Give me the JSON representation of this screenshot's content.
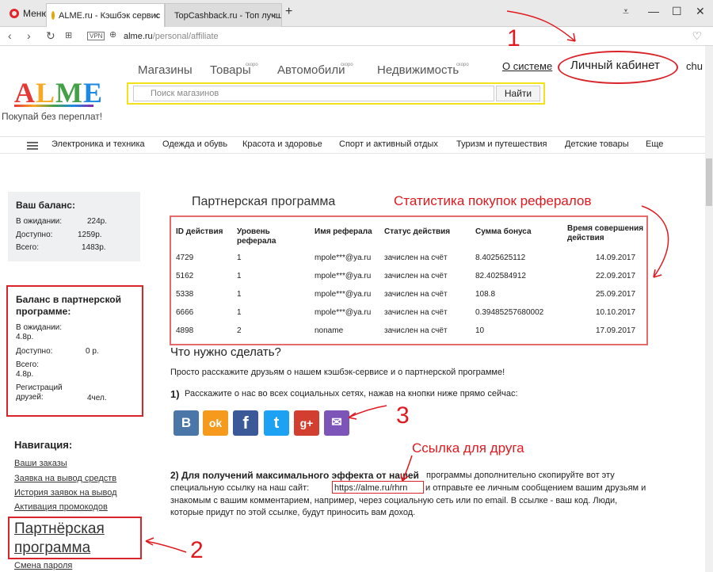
{
  "browser": {
    "menu_label": "Меню",
    "tabs": [
      {
        "title": "ALME.ru - Кэшбэк сервис",
        "close": "×"
      },
      {
        "title": "TopCashback.ru - Топ лучш",
        "close": "×"
      }
    ],
    "new_tab": "+",
    "url_host": "alme.ru",
    "url_path": "/personal/affiliate",
    "vpn_label": "VPN"
  },
  "header": {
    "logo_letters": [
      "A",
      "L",
      "M",
      "E"
    ],
    "slogan": "Покупай без переплат!",
    "nav": [
      {
        "label": "Магазины",
        "soon": ""
      },
      {
        "label": "Товары",
        "soon": "скоро"
      },
      {
        "label": "Автомобили",
        "soon": "скоро"
      },
      {
        "label": "Недвижимость",
        "soon": "скоро"
      }
    ],
    "about": "О системе",
    "cabinet": "Личный кабинет",
    "user_short": "chu",
    "search_placeholder": "Поиск магазинов",
    "search_button": "Найти",
    "categories": [
      "Электроника и техника",
      "Одежда и обувь",
      "Красота и здоровье",
      "Спорт и активный отдых",
      "Туризм и путешествия",
      "Детские товары",
      "Еще"
    ]
  },
  "sidebar": {
    "balance": {
      "title": "Ваш баланс:",
      "rows": [
        {
          "label": "В ожидании:",
          "value": "224р."
        },
        {
          "label": "Доступно:",
          "value": "1259р."
        },
        {
          "label": "Всего:",
          "value": "1483р."
        }
      ]
    },
    "partner_balance": {
      "title": "Баланс в партнерской программе:",
      "pending_label": "В ожидании:",
      "pending_value": "4.8р.",
      "available_label": "Доступно:",
      "available_value": "0 р.",
      "total_label": "Всего:",
      "total_value": "4.8р.",
      "registrations_label": "Регистраций друзей:",
      "registrations_value": "4чел."
    },
    "nav_title": "Навигация:",
    "nav_links": [
      "Ваши заказы",
      "Заявка на вывод средств",
      "История заявок на вывод",
      "Активация промокодов"
    ],
    "partner_link": "Партнёрская программа",
    "password_link": "Смена пароля"
  },
  "main": {
    "title": "Партнерская программа",
    "stats_annotation": "Статистика покупок рефералов",
    "table": {
      "headers": [
        "ID действия",
        "Уровень реферала",
        "Имя реферала",
        "Статус действия",
        "Сумма бонуса",
        "Время совершения действия"
      ],
      "rows": [
        [
          "4729",
          "1",
          "mpole***@ya.ru",
          "зачислен на счёт",
          "8.4025625112",
          "14.09.2017"
        ],
        [
          "5162",
          "1",
          "mpole***@ya.ru",
          "зачислен на счёт",
          "82.402584912",
          "22.09.2017"
        ],
        [
          "5338",
          "1",
          "mpole***@ya.ru",
          "зачислен на счёт",
          "108.8",
          "25.09.2017"
        ],
        [
          "6666",
          "1",
          "mpole***@ya.ru",
          "зачислен на счёт",
          "0.39485257680002",
          "10.10.2017"
        ],
        [
          "4898",
          "2",
          "noname",
          "зачислен на счёт",
          "10",
          "17.09.2017"
        ]
      ]
    },
    "todo_title": "Что нужно сделать?",
    "todo_intro": "Просто расскажите друзьям о нашем кэшбэк-сервисе и о партнерской программе!",
    "step1_num": "1)",
    "step1": "Расскажите о нас во всех социальных сетях, нажав на кнопки ниже прямо сейчас:",
    "social": [
      {
        "name": "vk",
        "glyph": "В",
        "color": "#4a76a8"
      },
      {
        "name": "ok",
        "glyph": "ok",
        "color": "#f59a1d"
      },
      {
        "name": "facebook",
        "glyph": "f",
        "color": "#3b5998"
      },
      {
        "name": "twitter",
        "glyph": "t",
        "color": "#1da1f2"
      },
      {
        "name": "google-plus",
        "glyph": "g+",
        "color": "#d23f31"
      },
      {
        "name": "email",
        "glyph": "✉",
        "color": "#7d55b8"
      }
    ],
    "friend_link_annotation": "Ссылка для друга",
    "step2_bold": "2) Для получений максимального эффекта от нашей",
    "step2_line1": "программы дополнительно скопируйте вот эту",
    "step2_line2_pre": "специальную ссылку на наш сайт:",
    "ref_link": "https://alme.ru/rhrn",
    "step2_line2_post": "и отправьте ее личным сообщением вашим друзьям и",
    "step2_line3": "знакомым с вашим комментарием, например, через социальную сеть или по email. В ссылке - ваш код. Люди,",
    "step2_line4": "которые придут по этой ссылке, будут приносить вам доход."
  },
  "annotations": {
    "n1": "1",
    "n2": "2",
    "n3": "3"
  }
}
